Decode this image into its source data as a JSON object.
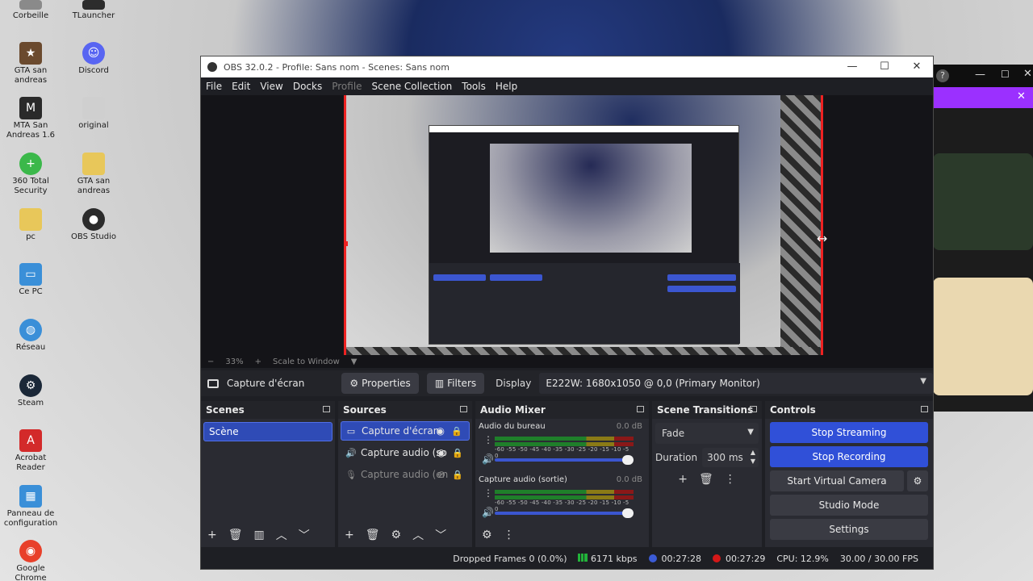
{
  "desktop": {
    "icons": [
      {
        "label": "Corbeille",
        "icon": "recycle-bin-icon",
        "color": "#8a8a8a"
      },
      {
        "label": "TLauncher",
        "icon": "tlauncher-icon",
        "color": "#2c2c2c"
      },
      {
        "label": "GTA san andreas",
        "icon": "gta-icon",
        "color": "#6b4a2e"
      },
      {
        "label": "Discord",
        "icon": "discord-icon",
        "color": "#5865f2"
      },
      {
        "label": "MTA San Andreas 1.6",
        "icon": "mta-icon",
        "color": "#2a2a2a"
      },
      {
        "label": "original",
        "icon": "file-icon",
        "color": "#cfcfcf"
      },
      {
        "label": "360 Total Security",
        "icon": "security-icon",
        "color": "#3bb84a"
      },
      {
        "label": "GTA san andreas",
        "icon": "folder-icon",
        "color": "#e8c75a"
      },
      {
        "label": "pc",
        "icon": "folder-icon",
        "color": "#e8c75a"
      },
      {
        "label": "OBS Studio",
        "icon": "obs-icon",
        "color": "#2b2b2b"
      },
      {
        "label": "Ce PC",
        "icon": "computer-icon",
        "color": "#3a8fd8"
      },
      {
        "label": "Réseau",
        "icon": "network-icon",
        "color": "#3a8fd8"
      },
      {
        "label": "Steam",
        "icon": "steam-icon",
        "color": "#1b2838"
      },
      {
        "label": "Acrobat Reader",
        "icon": "acrobat-icon",
        "color": "#d32a2a"
      },
      {
        "label": "Panneau de configuration",
        "icon": "control-panel-icon",
        "color": "#3a8fd8"
      },
      {
        "label": "Google Chrome",
        "icon": "chrome-icon",
        "color": "#e8402a"
      }
    ]
  },
  "obs": {
    "title": "OBS 32.0.2 - Profile: Sans nom - Scenes: Sans nom",
    "menu": [
      "File",
      "Edit",
      "View",
      "Docks",
      "Profile",
      "Scene Collection",
      "Tools",
      "Help"
    ],
    "zoom": {
      "minus": "−",
      "value": "33%",
      "plus": "+",
      "mode": "Scale to Window"
    },
    "source_toolbar": {
      "source_name": "Capture d'écran",
      "properties": "Properties",
      "filters": "Filters",
      "display_label": "Display",
      "display_value": "E222W: 1680x1050 @ 0,0 (Primary Monitor)"
    },
    "scenes": {
      "title": "Scenes",
      "items": [
        "Scène"
      ]
    },
    "sources": {
      "title": "Sources",
      "items": [
        "Capture d'écran",
        "Capture audio (so",
        "Capture audio (en"
      ]
    },
    "mixer": {
      "title": "Audio Mixer",
      "channels": [
        {
          "name": "Audio du bureau",
          "db": "0.0 dB"
        },
        {
          "name": "Capture audio (sortie)",
          "db": "0.0 dB"
        }
      ],
      "ticks": "-60 -55 -50 -45 -40 -35 -30 -25 -20 -15 -10 -5 0"
    },
    "transitions": {
      "title": "Scene Transitions",
      "type": "Fade",
      "duration_label": "Duration",
      "duration_value": "300 ms"
    },
    "controls": {
      "title": "Controls",
      "stop_streaming": "Stop Streaming",
      "stop_recording": "Stop Recording",
      "virtual_camera": "Start Virtual Camera",
      "studio_mode": "Studio Mode",
      "settings": "Settings"
    },
    "status": {
      "dropped": "Dropped Frames 0 (0.0%)",
      "bitrate": "6171 kbps",
      "stream_time": "00:27:28",
      "record_time": "00:27:29",
      "cpu": "CPU: 12.9%",
      "fps": "30.00 / 30.00 FPS"
    }
  },
  "colors": {
    "accent": "#3050d8",
    "record": "#d41818",
    "panel": "#2a2b32"
  }
}
